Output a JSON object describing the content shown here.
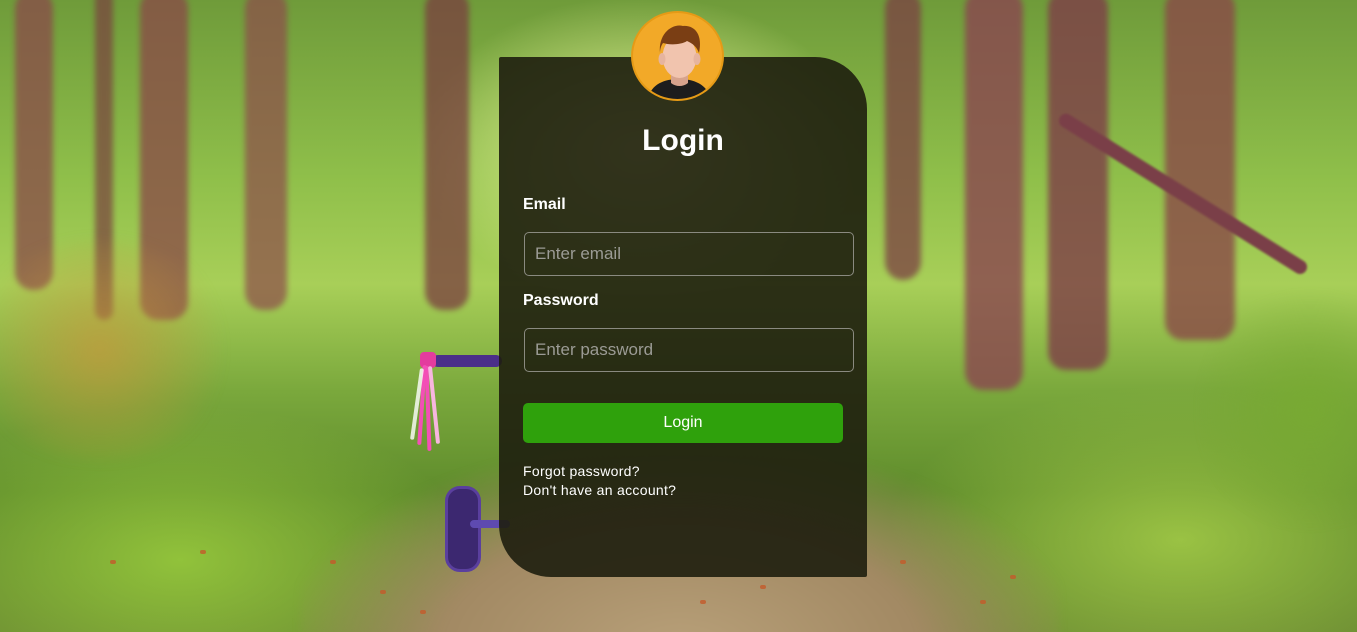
{
  "login": {
    "title": "Login",
    "email_label": "Email",
    "email_placeholder": "Enter email",
    "email_value": "",
    "password_label": "Password",
    "password_placeholder": "Enter password",
    "password_value": "",
    "submit_label": "Login",
    "forgot_password": "Forgot password?",
    "no_account": "Don't have an account?"
  },
  "avatar": {
    "icon": "user-avatar-icon"
  },
  "colors": {
    "card_background": "#1e1e0e",
    "button": "#2fa10c",
    "avatar_background": "#f2a928"
  }
}
